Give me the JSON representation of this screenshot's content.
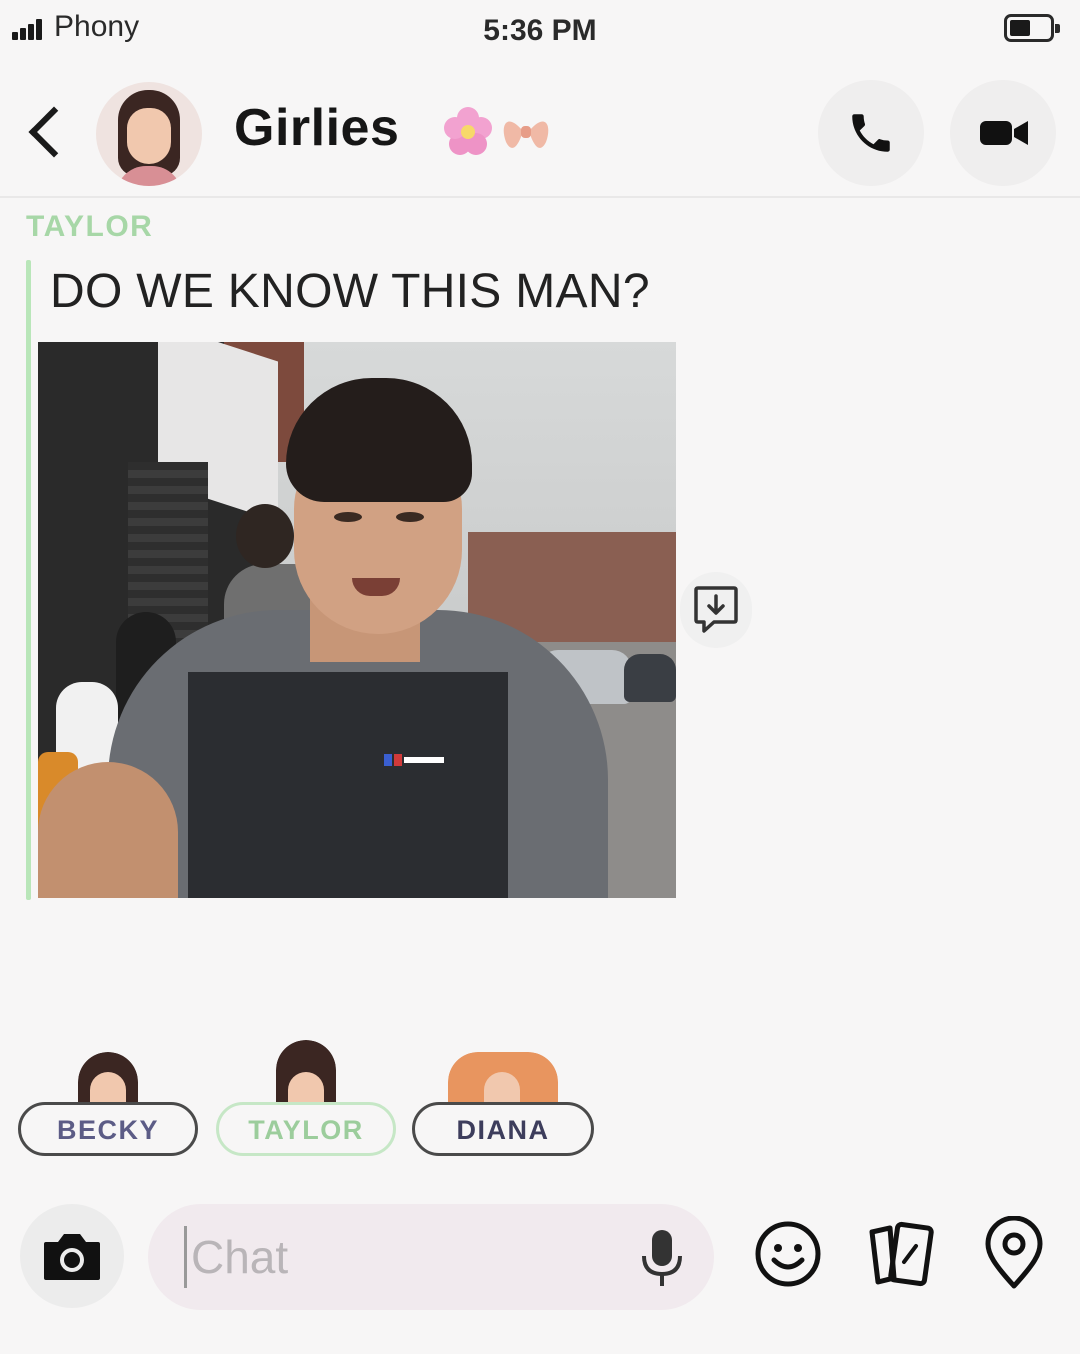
{
  "status_bar": {
    "carrier": "Phony",
    "time": "5:36 PM",
    "battery_level": 0.55
  },
  "header": {
    "title": "Girlies",
    "title_emoji": "🌸🎀",
    "back_icon": "chevron-left-icon",
    "call_icon": "phone-icon",
    "video_icon": "video-camera-icon"
  },
  "message": {
    "sender": "TAYLOR",
    "text": "DO WE KNOW THIS MAN?",
    "sender_color": "#a7d7a7",
    "image_description_icon": "photo"
  },
  "save_icon": "download-to-chat-icon",
  "participants": [
    {
      "name": "BECKY",
      "active": false
    },
    {
      "name": "TAYLOR",
      "active": true
    },
    {
      "name": "DIANA",
      "active": false
    }
  ],
  "input": {
    "placeholder": "Chat",
    "camera_icon": "camera-icon",
    "mic_icon": "microphone-icon",
    "emoji_icon": "smiley-icon",
    "cards_icon": "cards-icon",
    "location_icon": "location-pin-icon"
  }
}
